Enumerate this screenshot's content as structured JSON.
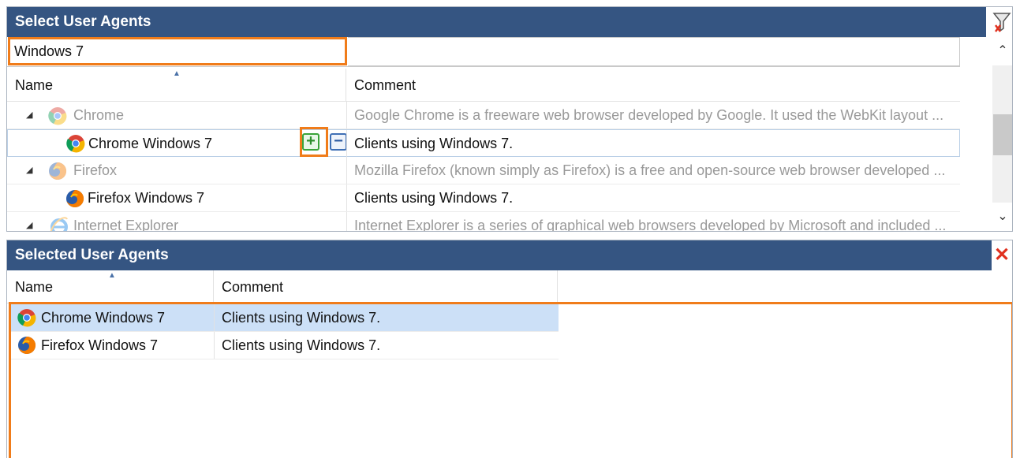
{
  "select_panel": {
    "title": "Select User Agents",
    "filter_value": "Windows 7",
    "columns": {
      "name": "Name",
      "comment": "Comment"
    },
    "rows": [
      {
        "type": "group",
        "name": "Chrome",
        "comment": "Google Chrome is a freeware web browser developed by Google. It used the WebKit layout ...",
        "icon": "chrome-icon"
      },
      {
        "type": "item",
        "name": "Chrome Windows 7",
        "comment": "Clients using Windows 7.",
        "icon": "chrome-icon"
      },
      {
        "type": "group",
        "name": "Firefox",
        "comment": "Mozilla Firefox (known simply as Firefox) is a free and open-source web browser developed ...",
        "icon": "firefox-icon"
      },
      {
        "type": "item",
        "name": "Firefox Windows 7",
        "comment": "Clients using Windows 7.",
        "icon": "firefox-icon"
      },
      {
        "type": "group",
        "name": "Internet Explorer",
        "comment": "Internet Explorer is a series of graphical web browsers developed by Microsoft and included ...",
        "icon": "ie-icon"
      }
    ],
    "add_label": "+",
    "remove_label": "−",
    "scroll_up": "⌃",
    "scroll_down": "⌄"
  },
  "selected_panel": {
    "title": "Selected User Agents",
    "close_label": "✕",
    "columns": {
      "name": "Name",
      "comment": "Comment"
    },
    "rows": [
      {
        "name": "Chrome Windows 7",
        "comment": "Clients using Windows 7.",
        "icon": "chrome-icon",
        "selected": true
      },
      {
        "name": "Firefox Windows 7",
        "comment": "Clients using Windows 7.",
        "icon": "firefox-icon",
        "selected": false
      }
    ]
  },
  "colors": {
    "title_bar": "#355582",
    "highlight": "#f07c1a",
    "selected_row": "#cce0f7"
  }
}
